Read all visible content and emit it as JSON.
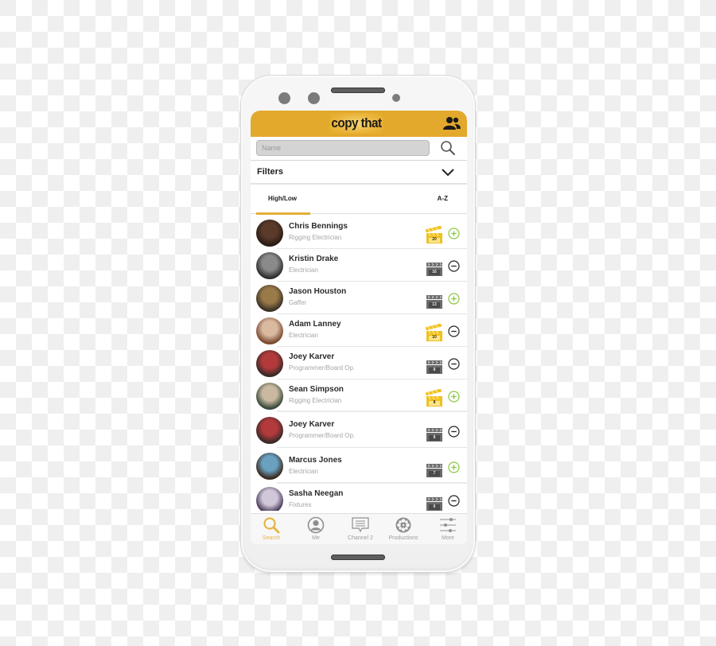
{
  "app": {
    "logo_text": "copy that",
    "brand_color": "#e2a92c"
  },
  "search": {
    "placeholder": "Name",
    "value": ""
  },
  "filters": {
    "label": "Filters"
  },
  "sort_tabs": [
    {
      "label": "High/Low",
      "active": true
    },
    {
      "label": "A-Z",
      "active": false
    }
  ],
  "crew": [
    {
      "name": "Chris Bennings",
      "role": "Rigging Electrician",
      "credits": "20",
      "badge": "gold",
      "action": "add"
    },
    {
      "name": "Kristin Drake",
      "role": "Electrician",
      "credits": "16",
      "badge": "gray",
      "action": "remove"
    },
    {
      "name": "Jason Houston",
      "role": "Gaffer",
      "credits": "13",
      "badge": "gray",
      "action": "add"
    },
    {
      "name": "Adam Lanney",
      "role": "Electrician",
      "credits": "10",
      "badge": "gold",
      "action": "remove"
    },
    {
      "name": "Joey Karver",
      "role": "Programmer/Board Op.",
      "credits": "8",
      "badge": "gray",
      "action": "remove"
    },
    {
      "name": "Sean Simpson",
      "role": "Rigging Electrician",
      "credits": "8",
      "badge": "gold",
      "action": "add"
    },
    {
      "name": "Joey Karver",
      "role": "Programmer/Board Op.",
      "credits": "8",
      "badge": "gray",
      "action": "remove"
    },
    {
      "name": "Marcus Jones",
      "role": "Electrician",
      "credits": "7",
      "badge": "gray",
      "action": "add"
    },
    {
      "name": "Sasha Neegan",
      "role": "Fixtures",
      "credits": "6",
      "badge": "gray",
      "action": "remove"
    }
  ],
  "tabbar": [
    {
      "label": "Search",
      "icon": "search-icon",
      "active": true
    },
    {
      "label": "Me",
      "icon": "user-icon",
      "active": false
    },
    {
      "label": "Channel 2",
      "icon": "chat-icon",
      "active": false
    },
    {
      "label": "Productions",
      "icon": "film-reel-icon",
      "active": false
    },
    {
      "label": "More",
      "icon": "sliders-icon",
      "active": false
    }
  ],
  "colors": {
    "add": "#8cc63f",
    "remove": "#222222",
    "gold_badge": "#f0c020",
    "gray_badge": "#6b6b6b",
    "active_tab": "#e8b442"
  }
}
